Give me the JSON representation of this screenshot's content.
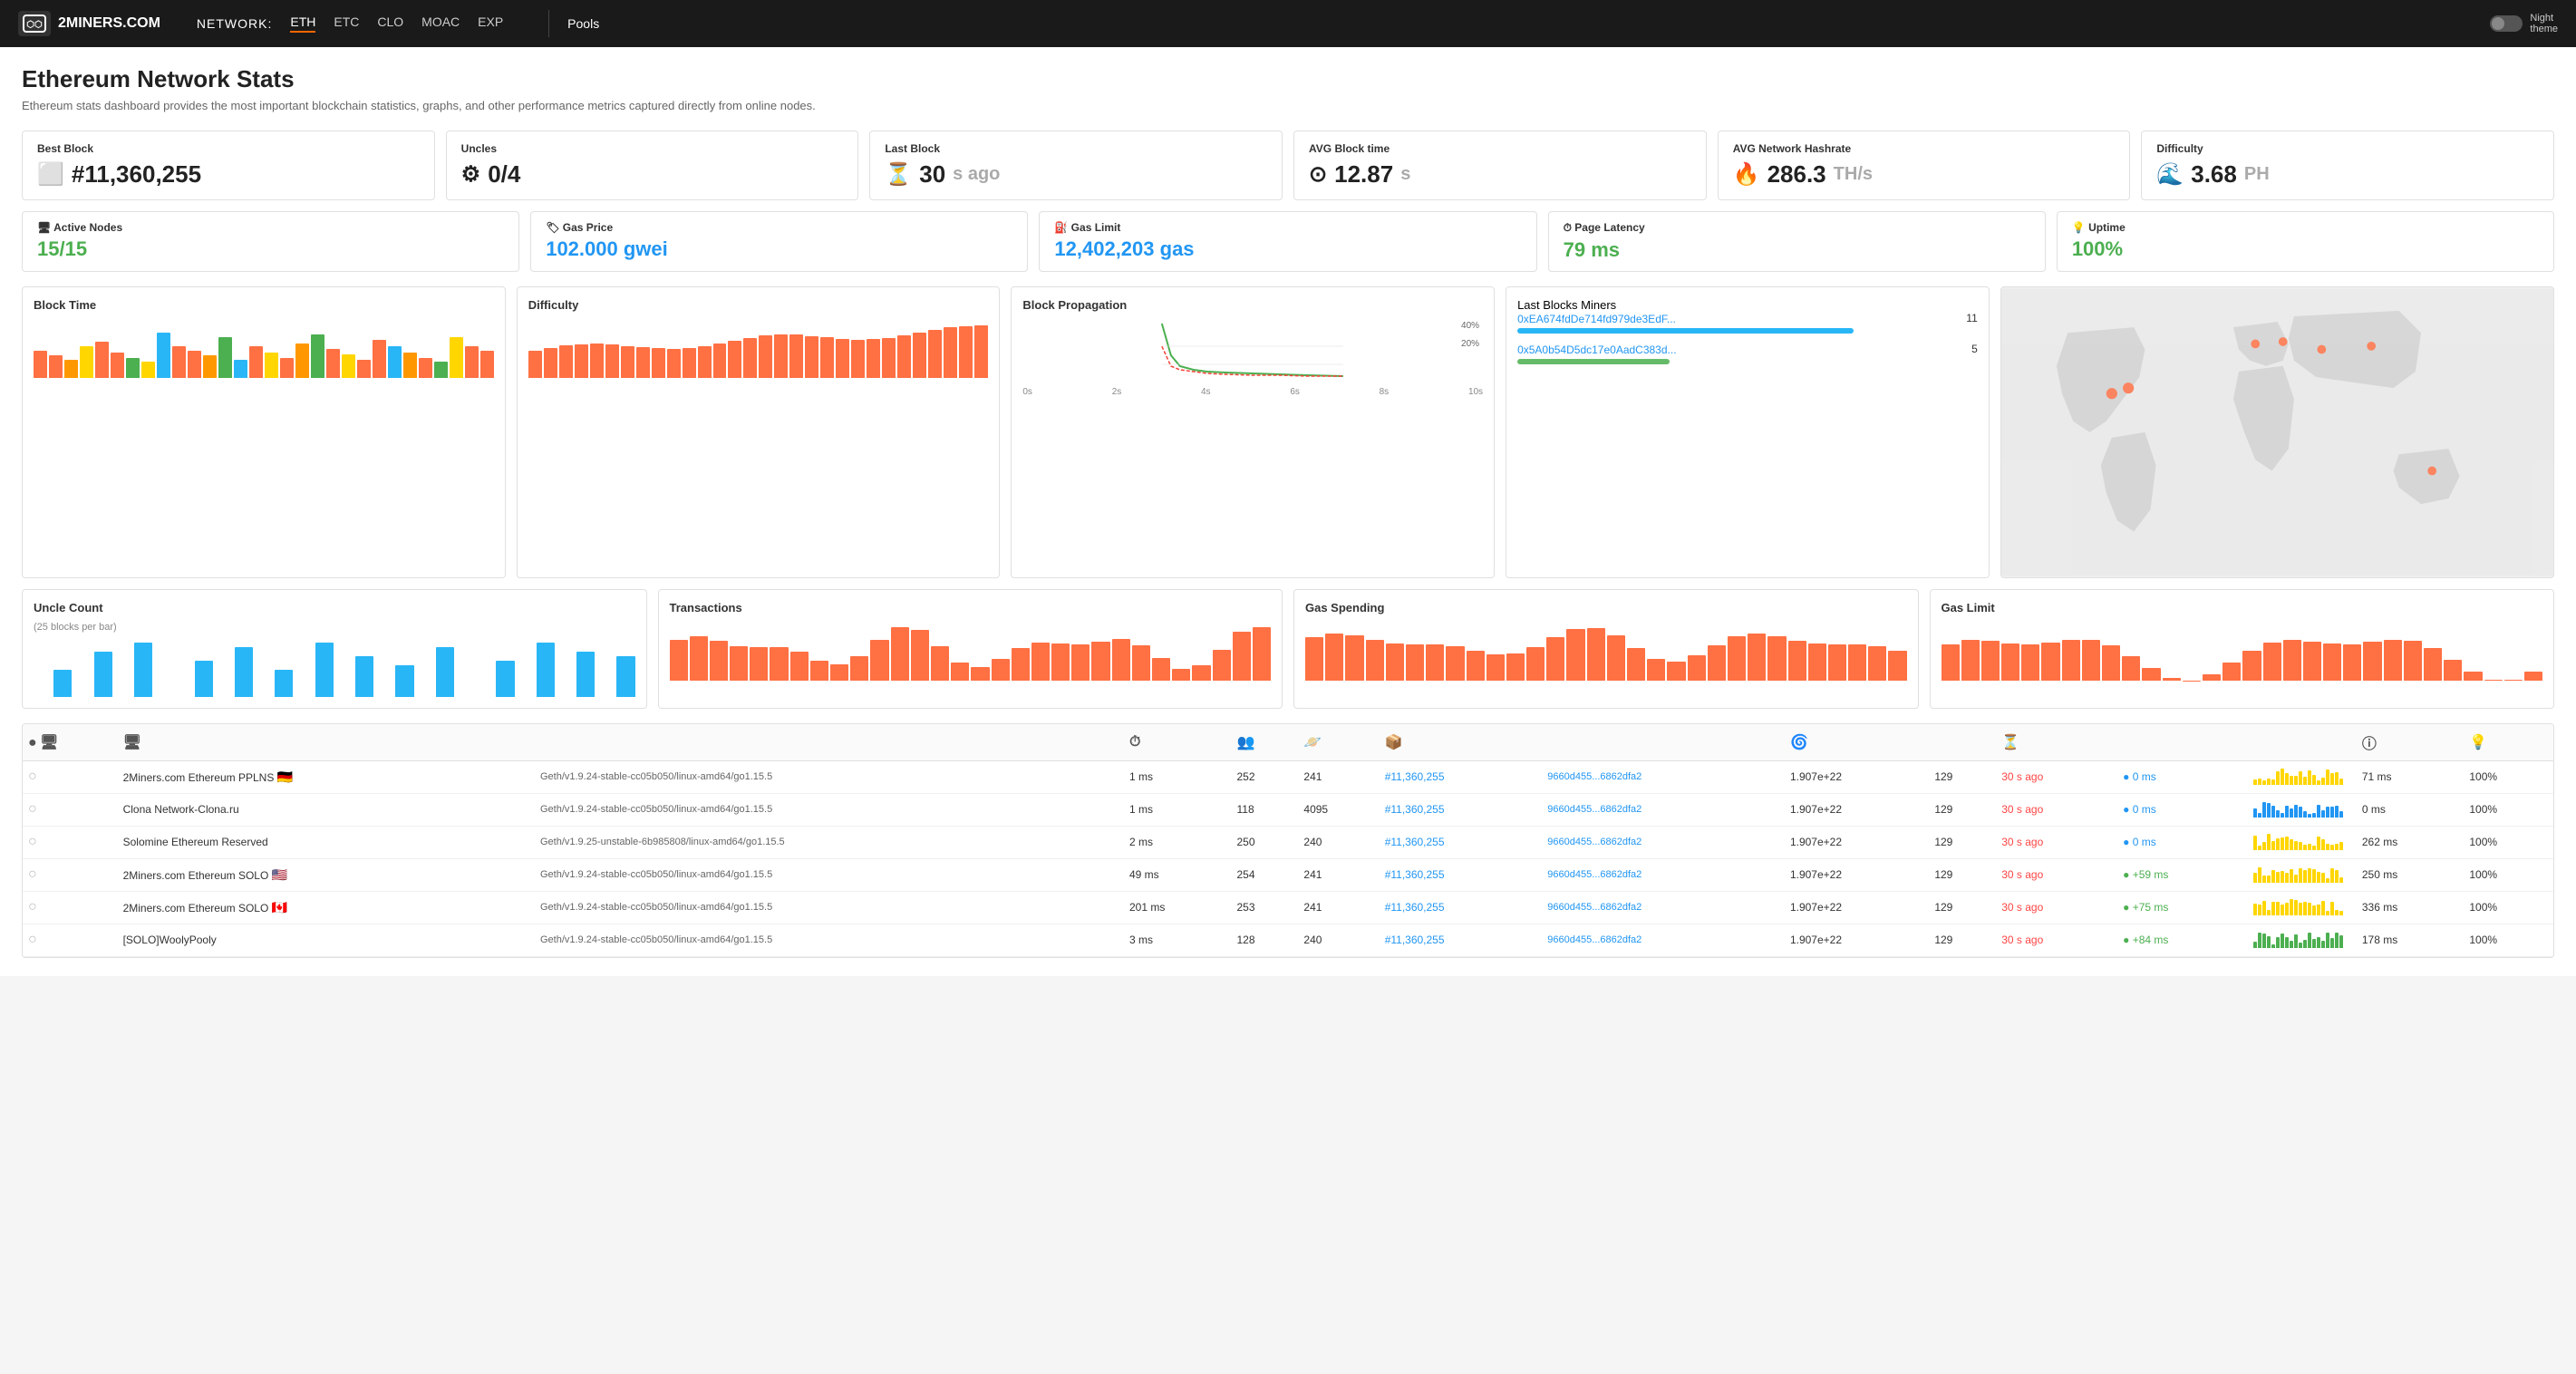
{
  "header": {
    "logo_text": "2MINERS.COM",
    "network_label": "NETWORK:",
    "nav_items": [
      "ETH",
      "ETC",
      "CLO",
      "MOAC",
      "EXP"
    ],
    "active_nav": "ETH",
    "pools_label": "Pools",
    "night_theme_label": "Night\ntheme"
  },
  "page": {
    "title": "Ethereum Network Stats",
    "subtitle": "Ethereum stats dashboard provides the most important blockchain statistics, graphs, and other performance metrics captured directly from online nodes."
  },
  "stats_row1": {
    "cards": [
      {
        "label": "Best Block",
        "value": "#11,360,255",
        "icon": "⬜",
        "unit": ""
      },
      {
        "label": "Uncles",
        "value": "0/4",
        "icon": "⚙",
        "unit": ""
      },
      {
        "label": "Last Block",
        "value": "30",
        "unit": "s ago",
        "icon": "⏳"
      },
      {
        "label": "AVG Block time",
        "value": "12.87",
        "unit": "s",
        "icon": "⊙"
      },
      {
        "label": "AVG Network Hashrate",
        "value": "286.3",
        "unit": "TH/s",
        "icon": "🔥"
      },
      {
        "label": "Difficulty",
        "value": "3.68",
        "unit": "PH",
        "icon": "🌀"
      }
    ]
  },
  "stats_row2": {
    "cards": [
      {
        "label": "Active Nodes",
        "value": "15/15",
        "color": "green",
        "icon": "🖥"
      },
      {
        "label": "Gas Price",
        "value": "102.000 gwei",
        "color": "blue",
        "icon": "🏷"
      },
      {
        "label": "Gas Limit",
        "value": "12,402,203 gas",
        "color": "blue",
        "icon": "⛽"
      },
      {
        "label": "Page Latency",
        "value": "79 ms",
        "color": "green",
        "icon": "⏱"
      },
      {
        "label": "Uptime",
        "value": "100%",
        "color": "green",
        "icon": "💡"
      }
    ]
  },
  "chart_labels": {
    "block_time": "Block Time",
    "difficulty": "Difficulty",
    "block_propagation": "Block Propagation",
    "last_blocks_miners": "Last Blocks Miners",
    "uncle_count": "Uncle Count",
    "uncle_count_subtitle": "(25 blocks per bar)",
    "transactions": "Transactions",
    "gas_spending": "Gas Spending",
    "gas_limit": "Gas Limit"
  },
  "miners": [
    {
      "addr": "0xEA674fdDe714fd979de3EdF...",
      "count": 11,
      "color": "#29b6f6",
      "pct": 73
    },
    {
      "addr": "0x5A0b54D5dc17e0AadC383d...",
      "count": 5,
      "color": "#66bb6a",
      "pct": 33
    }
  ],
  "table_headers": {
    "status": "●",
    "node": "🖥",
    "client": "",
    "latency": "⏱",
    "peers": "👥",
    "pending": "🪐",
    "block": "📦",
    "block_hash": "",
    "difficulty": "🌀",
    "total_difficulty": "",
    "last_block": "⏳",
    "propagation": "",
    "chart": "",
    "uptime_latency": "ⓘ",
    "uptime": "💡"
  },
  "nodes": [
    {
      "status": "○",
      "name": "2Miners.com Ethereum PPLNS",
      "flag": "🇩🇪",
      "client": "Geth/v1.9.24-stable-cc05b050/linux-amd64/go1.15.5",
      "latency": "1 ms",
      "peers": "252",
      "pending": "241",
      "block": "#11,360,255",
      "block_hash": "9660d455...6862dfa2",
      "difficulty": "1.907e+22",
      "total_diff": "129",
      "last_block": "30 s ago",
      "propagation": "● 0 ms",
      "prop_color": "blue",
      "sparkline_color": "#ffd600",
      "uptime_lat": "71 ms",
      "uptime": "100%"
    },
    {
      "status": "○",
      "name": "Clona Network-Clona.ru",
      "flag": "",
      "client": "Geth/v1.9.24-stable-cc05b050/linux-amd64/go1.15.5",
      "latency": "1 ms",
      "peers": "118",
      "pending": "4095",
      "block": "#11,360,255",
      "block_hash": "9660d455...6862dfa2",
      "difficulty": "1.907e+22",
      "total_diff": "129",
      "last_block": "30 s ago",
      "propagation": "● 0 ms",
      "prop_color": "blue",
      "sparkline_color": "#2196f3",
      "uptime_lat": "0 ms",
      "uptime": "100%"
    },
    {
      "status": "○",
      "name": "Solomine Ethereum Reserved",
      "flag": "",
      "client": "Geth/v1.9.25-unstable-6b985808/linux-amd64/go1.15.5",
      "latency": "2 ms",
      "peers": "250",
      "pending": "240",
      "block": "#11,360,255",
      "block_hash": "9660d455...6862dfa2",
      "difficulty": "1.907e+22",
      "total_diff": "129",
      "last_block": "30 s ago",
      "propagation": "● 0 ms",
      "prop_color": "blue",
      "sparkline_color": "#ffd600",
      "uptime_lat": "262 ms",
      "uptime": "100%"
    },
    {
      "status": "○",
      "name": "2Miners.com Ethereum SOLO",
      "flag": "🇺🇸",
      "client": "Geth/v1.9.24-stable-cc05b050/linux-amd64/go1.15.5",
      "latency": "49 ms",
      "peers": "254",
      "pending": "241",
      "block": "#11,360,255",
      "block_hash": "9660d455...6862dfa2",
      "difficulty": "1.907e+22",
      "total_diff": "129",
      "last_block": "30 s ago",
      "propagation": "● +59 ms",
      "prop_color": "green",
      "sparkline_color": "#ffd600",
      "uptime_lat": "250 ms",
      "uptime": "100%"
    },
    {
      "status": "○",
      "name": "2Miners.com Ethereum SOLO",
      "flag": "🇨🇦",
      "client": "Geth/v1.9.24-stable-cc05b050/linux-amd64/go1.15.5",
      "latency": "201 ms",
      "peers": "253",
      "pending": "241",
      "block": "#11,360,255",
      "block_hash": "9660d455...6862dfa2",
      "difficulty": "1.907e+22",
      "total_diff": "129",
      "last_block": "30 s ago",
      "propagation": "● +75 ms",
      "prop_color": "green",
      "sparkline_color": "#ffd600",
      "uptime_lat": "336 ms",
      "uptime": "100%"
    },
    {
      "status": "○",
      "name": "[SOLO]WoolyPooly",
      "flag": "",
      "client": "Geth/v1.9.24-stable-cc05b050/linux-amd64/go1.15.5",
      "latency": "3 ms",
      "peers": "128",
      "pending": "240",
      "block": "#11,360,255",
      "block_hash": "9660d455...6862dfa2",
      "difficulty": "1.907e+22",
      "total_diff": "129",
      "last_block": "30 s ago",
      "propagation": "● +84 ms",
      "prop_color": "green",
      "sparkline_color": "#4caf50",
      "uptime_lat": "178 ms",
      "uptime": "100%"
    }
  ],
  "colors": {
    "orange": "#f57c00",
    "orange_bar": "#ff7043",
    "cyan": "#29b6f6",
    "green": "#4caf50",
    "yellow": "#ffd600",
    "accent": "#f60"
  }
}
